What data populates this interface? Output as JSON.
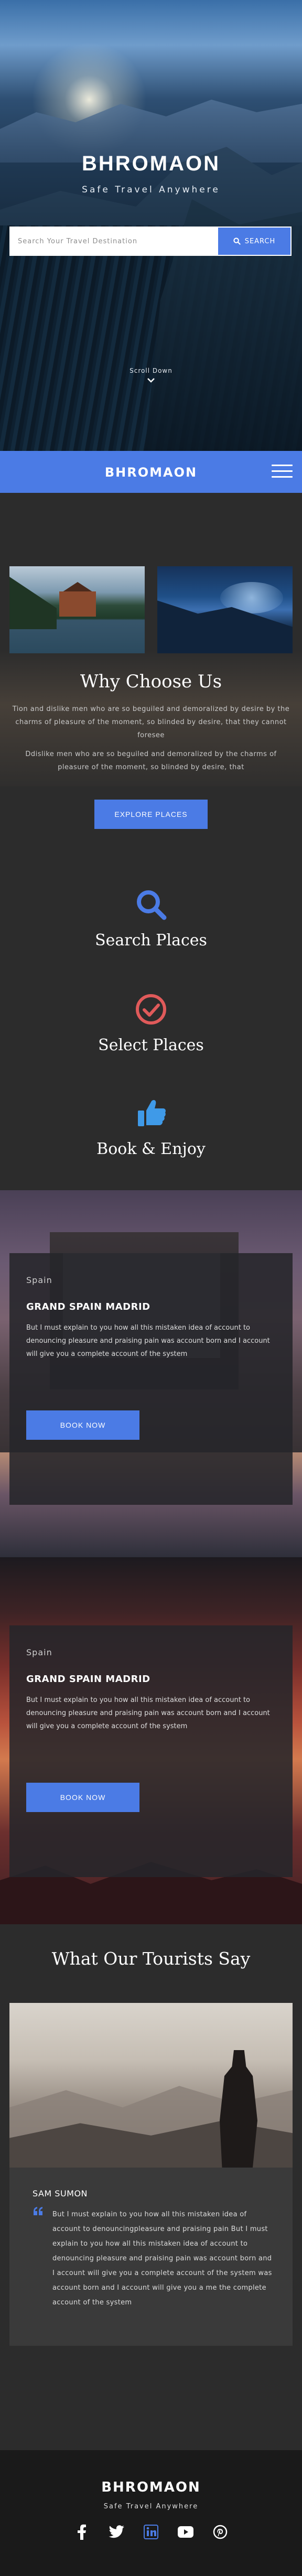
{
  "hero": {
    "title": "BHROMAON",
    "subtitle": "Safe Travel Anywhere",
    "search_placeholder": "Search Your Travel Destination",
    "search_button": "SEARCH",
    "scroll_label": "Scroll Down"
  },
  "navbar": {
    "logo": "BHROMAON",
    "menu_icon": "hamburger-icon"
  },
  "why": {
    "title": "Why Choose Us",
    "paragraph1": "Tion and dislike men who are so beguiled and demoralized by desire by the charms of pleasure of the moment, so blinded by desire, that they cannot foresee",
    "paragraph2": "Ddislike men who are so beguiled and demoralized by the charms of pleasure of the moment, so blinded by desire, that",
    "button": "EXPLORE PLACES"
  },
  "features": [
    {
      "label": "Search Places",
      "icon": "search-icon",
      "color": "#4b7be5"
    },
    {
      "label": "Select Places",
      "icon": "check-circle-icon",
      "color": "#e05a5a"
    },
    {
      "label": "Book & Enjoy",
      "icon": "thumbs-up-icon",
      "color": "#3f9ae8"
    }
  ],
  "destinations": [
    {
      "country": "Spain",
      "title": "GRAND SPAIN MADRID",
      "text": "But I must explain to you how all this mistaken idea of account to denouncing pleasure and praising pain was account  born and I account will give you a complete account of the system",
      "button": "BOOK NOW"
    },
    {
      "country": "Spain",
      "title": "GRAND SPAIN MADRID",
      "text": "But I must explain to you how all this mistaken idea of account to denouncing pleasure and praising pain was account  born and I account will give you a complete account of the system",
      "button": "BOOK NOW"
    }
  ],
  "testimonial": {
    "section_title": "What Our  Tourists Say",
    "name": "SAM SUMON",
    "text": "But I must explain to you how all this mistaken idea of account to denouncingpleasure and praising pain  But I must explain to you how all this mistaken idea of account to denouncing pleasure and praising pain was account  born and I account will give you a complete account of the system was account  born and I account will give you a me the complete account of the system"
  },
  "footer": {
    "logo": "BHROMAON",
    "subtitle": "Safe Travel Anywhere",
    "socials": [
      "facebook-icon",
      "twitter-icon",
      "linkedin-icon",
      "youtube-icon",
      "pinterest-icon"
    ]
  },
  "colors": {
    "accent": "#4b7be5",
    "background": "#2c2c2c",
    "footer": "#1a1a1a"
  }
}
